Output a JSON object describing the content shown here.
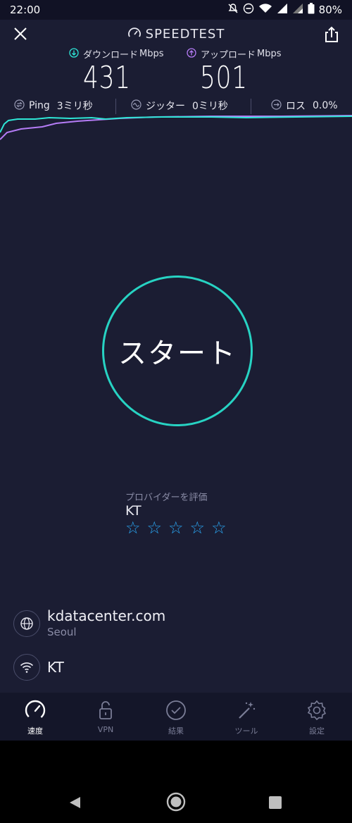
{
  "status_bar": {
    "time": "22:00",
    "battery": "80%",
    "icons": [
      "mute-icon",
      "dnd-icon",
      "wifi-icon",
      "signal-icon",
      "signal-icon",
      "battery-icon"
    ]
  },
  "header": {
    "title": "SPEEDTEST",
    "close_icon": "close-icon",
    "share_icon": "share-icon",
    "title_icon": "speedometer-icon"
  },
  "metrics": {
    "download": {
      "label": "ダウンロード",
      "unit": "Mbps",
      "value": "431",
      "color": "#2ee6d6"
    },
    "upload": {
      "label": "アップロード",
      "unit": "Mbps",
      "value": "501",
      "color": "#b57cf6"
    }
  },
  "latency": {
    "ping": {
      "label": "Ping",
      "value": "3ミリ秒"
    },
    "jitter": {
      "label": "ジッター",
      "value": "0ミリ秒"
    },
    "loss": {
      "label": "ロス",
      "value": "0.0%"
    }
  },
  "start": {
    "label": "スタート",
    "color": "#27d3c3"
  },
  "rating": {
    "prompt": "プロバイダーを評価",
    "isp": "KT",
    "stars": 5,
    "star_color": "#2aa3ee"
  },
  "server": {
    "host": "kdatacenter.com",
    "city": "Seoul",
    "icon": "globe-icon"
  },
  "connection": {
    "isp": "KT",
    "icon": "wifi-icon"
  },
  "nav": [
    {
      "label": "速度",
      "icon": "speedometer-icon",
      "active": true
    },
    {
      "label": "VPN",
      "icon": "lock-icon",
      "active": false
    },
    {
      "label": "結果",
      "icon": "check-circle-icon",
      "active": false
    },
    {
      "label": "ツール",
      "icon": "magic-wand-icon",
      "active": false
    },
    {
      "label": "設定",
      "icon": "gear-icon",
      "active": false
    }
  ],
  "system_nav": [
    "back-icon",
    "home-icon",
    "recents-icon"
  ]
}
